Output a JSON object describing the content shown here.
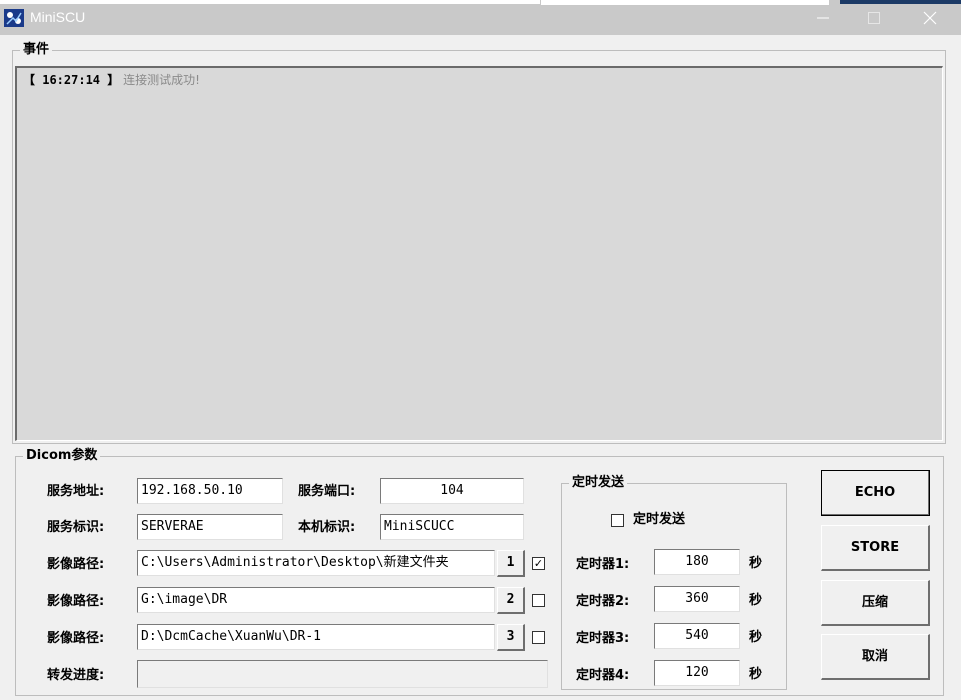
{
  "window": {
    "title": "MiniSCU",
    "minimize_icon": "minimize-icon",
    "maximize_icon": "maximize-icon",
    "close_icon": "close-icon"
  },
  "events": {
    "label": "事件",
    "entries": [
      {
        "time": "【 16:27:14 】",
        "message": "连接测试成功!"
      }
    ]
  },
  "dicom": {
    "label": "Dicom参数",
    "server_address_label": "服务地址:",
    "server_address": "192.168.50.10",
    "server_port_label": "服务端口:",
    "server_port": "104",
    "server_ae_label": "服务标识:",
    "server_ae": "SERVERAE",
    "local_ae_label": "本机标识:",
    "local_ae": "MiniSCUCC",
    "image_paths": [
      {
        "label": "影像路径:",
        "value": "C:\\Users\\Administrator\\Desktop\\新建文件夹",
        "button": "1",
        "checked": true,
        "check_mark": "✓"
      },
      {
        "label": "影像路径:",
        "value": "G:\\image\\DR",
        "button": "2",
        "checked": false,
        "check_mark": ""
      },
      {
        "label": "影像路径:",
        "value": "D:\\DcmCache\\XuanWu\\DR-1",
        "button": "3",
        "checked": false,
        "check_mark": ""
      }
    ],
    "progress_label": "转发进度:",
    "progress_value": ""
  },
  "timer": {
    "label": "定时发送",
    "enable_label": "定时发送",
    "enabled": false,
    "unit": "秒",
    "timers": [
      {
        "label": "定时器1:",
        "value": "180"
      },
      {
        "label": "定时器2:",
        "value": "360"
      },
      {
        "label": "定时器3:",
        "value": "540"
      },
      {
        "label": "定时器4:",
        "value": "120"
      }
    ]
  },
  "buttons": {
    "echo": "ECHO",
    "store": "STORE",
    "compress": "压缩",
    "cancel": "取消"
  }
}
